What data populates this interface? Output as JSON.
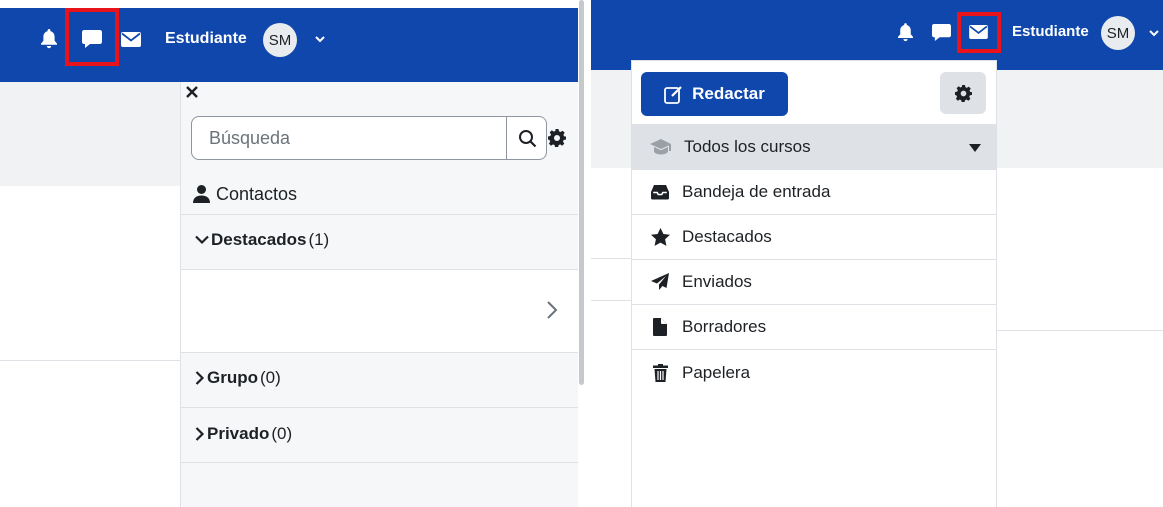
{
  "left": {
    "navbar": {
      "username": "Estudiante",
      "avatar_initials": "SM",
      "highlighted": "messages-icon"
    },
    "drawer": {
      "search_placeholder": "Búsqueda",
      "contacts_label": "Contactos",
      "sections": [
        {
          "name": "Destacados",
          "count": "(1)",
          "expanded": true
        },
        {
          "name": "Grupo",
          "count": "(0)",
          "expanded": false
        },
        {
          "name": "Privado",
          "count": "(0)",
          "expanded": false
        }
      ]
    }
  },
  "right": {
    "navbar": {
      "username": "Estudiante",
      "avatar_initials": "SM",
      "highlighted": "mail-icon"
    },
    "mail": {
      "compose_label": "Redactar",
      "course_filter": "Todos los cursos",
      "folders": [
        {
          "icon": "inbox-icon",
          "label": "Bandeja de entrada"
        },
        {
          "icon": "star-icon",
          "label": "Destacados"
        },
        {
          "icon": "paper-plane-icon",
          "label": "Enviados"
        },
        {
          "icon": "file-icon",
          "label": "Borradores"
        },
        {
          "icon": "trash-icon",
          "label": "Papelera"
        }
      ]
    }
  },
  "colors": {
    "navbar": "#0f47ad",
    "highlight": "#e8131b",
    "panel_bg": "#f6f7f8",
    "selected_bg": "#dee2e6"
  }
}
